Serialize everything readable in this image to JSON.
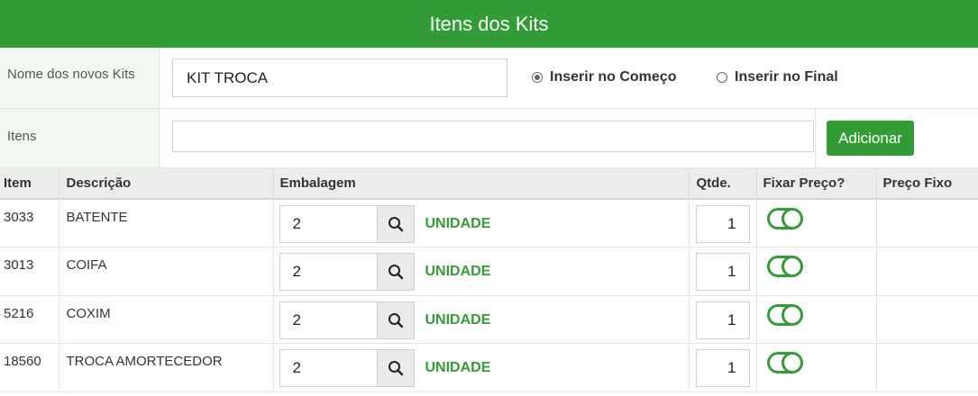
{
  "title": "Itens dos Kits",
  "form": {
    "nome_label": "Nome dos novos Kits",
    "nome_value": "KIT TROCA",
    "radio_inicio": "Inserir no Começo",
    "radio_final": "Inserir no Final",
    "itens_label": "Itens",
    "itens_value": "",
    "add_button": "Adicionar"
  },
  "table": {
    "headers": [
      "Item",
      "Descrição",
      "Embalagem",
      "Qtde.",
      "Fixar Preço?",
      "Preço Fixo"
    ],
    "rows": [
      {
        "item": "3033",
        "descricao": "BATENTE",
        "embalagem": "2",
        "unidade": "UNIDADE",
        "qtde": "1",
        "preco_fixo": ""
      },
      {
        "item": "3013",
        "descricao": "COIFA",
        "embalagem": "2",
        "unidade": "UNIDADE",
        "qtde": "1",
        "preco_fixo": ""
      },
      {
        "item": "5216",
        "descricao": "COXIM",
        "embalagem": "2",
        "unidade": "UNIDADE",
        "qtde": "1",
        "preco_fixo": ""
      },
      {
        "item": "18560",
        "descricao": "TROCA AMORTECEDOR",
        "embalagem": "2",
        "unidade": "UNIDADE",
        "qtde": "1",
        "preco_fixo": ""
      }
    ]
  },
  "colors": {
    "accent": "#349c37",
    "header_bg": "#ececec"
  },
  "icons": {
    "search": "search-icon",
    "toggle": "toggle-icon"
  }
}
